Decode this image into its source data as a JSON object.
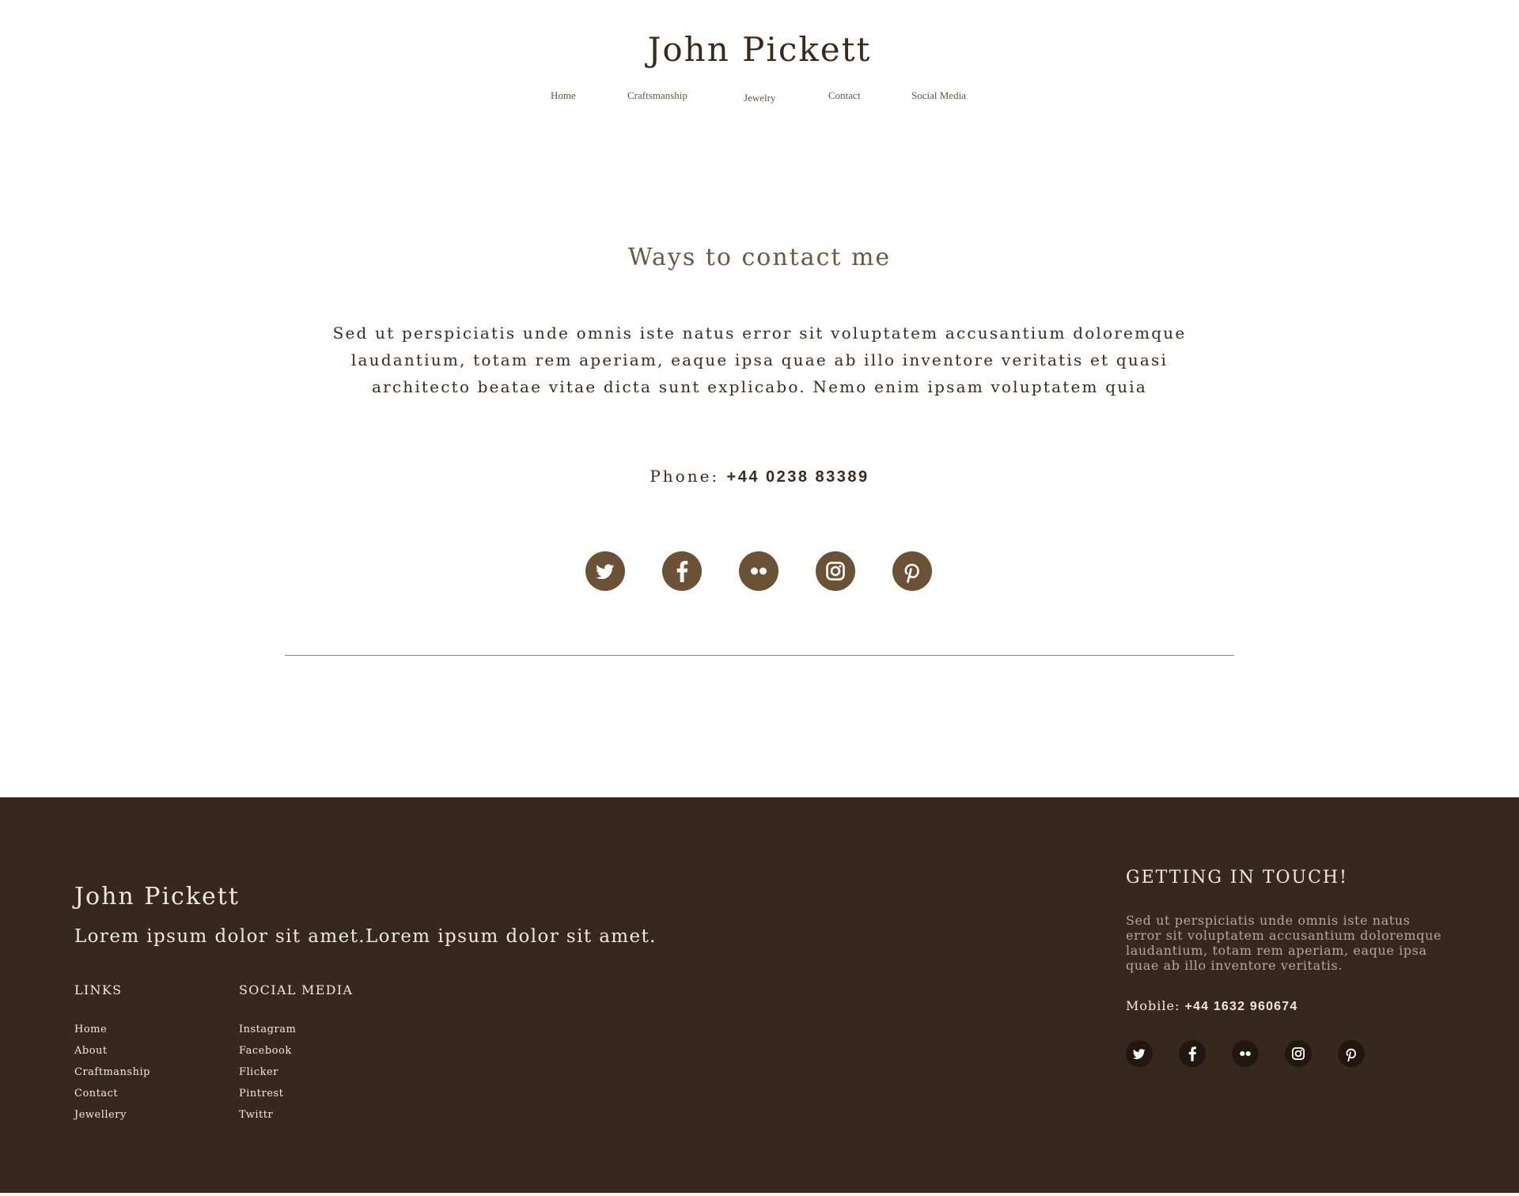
{
  "header": {
    "site_title": "John Pickett",
    "nav": [
      "Home",
      "Craftsmanship",
      "Jewelry",
      "Contact",
      "Social Media"
    ]
  },
  "main": {
    "heading": "Ways to contact me",
    "intro": "Sed ut perspiciatis unde omnis iste natus error sit voluptatem accusantium doloremque laudantium, totam rem aperiam, eaque ipsa quae ab illo inventore veritatis et quasi architecto beatae vitae dicta sunt explicabo. Nemo enim ipsam voluptatem quia",
    "phone_label": "Phone:",
    "phone_number": "+44 0238 83389",
    "social_icons": [
      "twitter-icon",
      "facebook-icon",
      "flickr-icon",
      "instagram-icon",
      "pinterest-icon"
    ]
  },
  "footer": {
    "title": "John Pickett",
    "tagline": "Lorem ipsum dolor sit amet.Lorem ipsum dolor sit amet.",
    "links_heading": "LINKS",
    "links": [
      "Home",
      "About",
      "Craftmanship",
      "Contact",
      "Jewellery"
    ],
    "social_heading": "SOCIAL MEDIA",
    "social_links": [
      "Instagram",
      "Facebook",
      "Flicker",
      "Pintrest",
      "Twittr"
    ],
    "touch_heading": "GETTING IN TOUCH!",
    "touch_text": "Sed ut perspiciatis unde omnis iste natus error sit voluptatem accusantium doloremque laudantium, totam rem aperiam, eaque ipsa quae ab illo inventore veritatis.",
    "mobile_label": "Mobile:",
    "mobile_number": "+44 1632 960674"
  },
  "colors": {
    "accent_brown": "#6b5234",
    "footer_bg": "#37281d",
    "footer_icon_bg": "#221710"
  }
}
